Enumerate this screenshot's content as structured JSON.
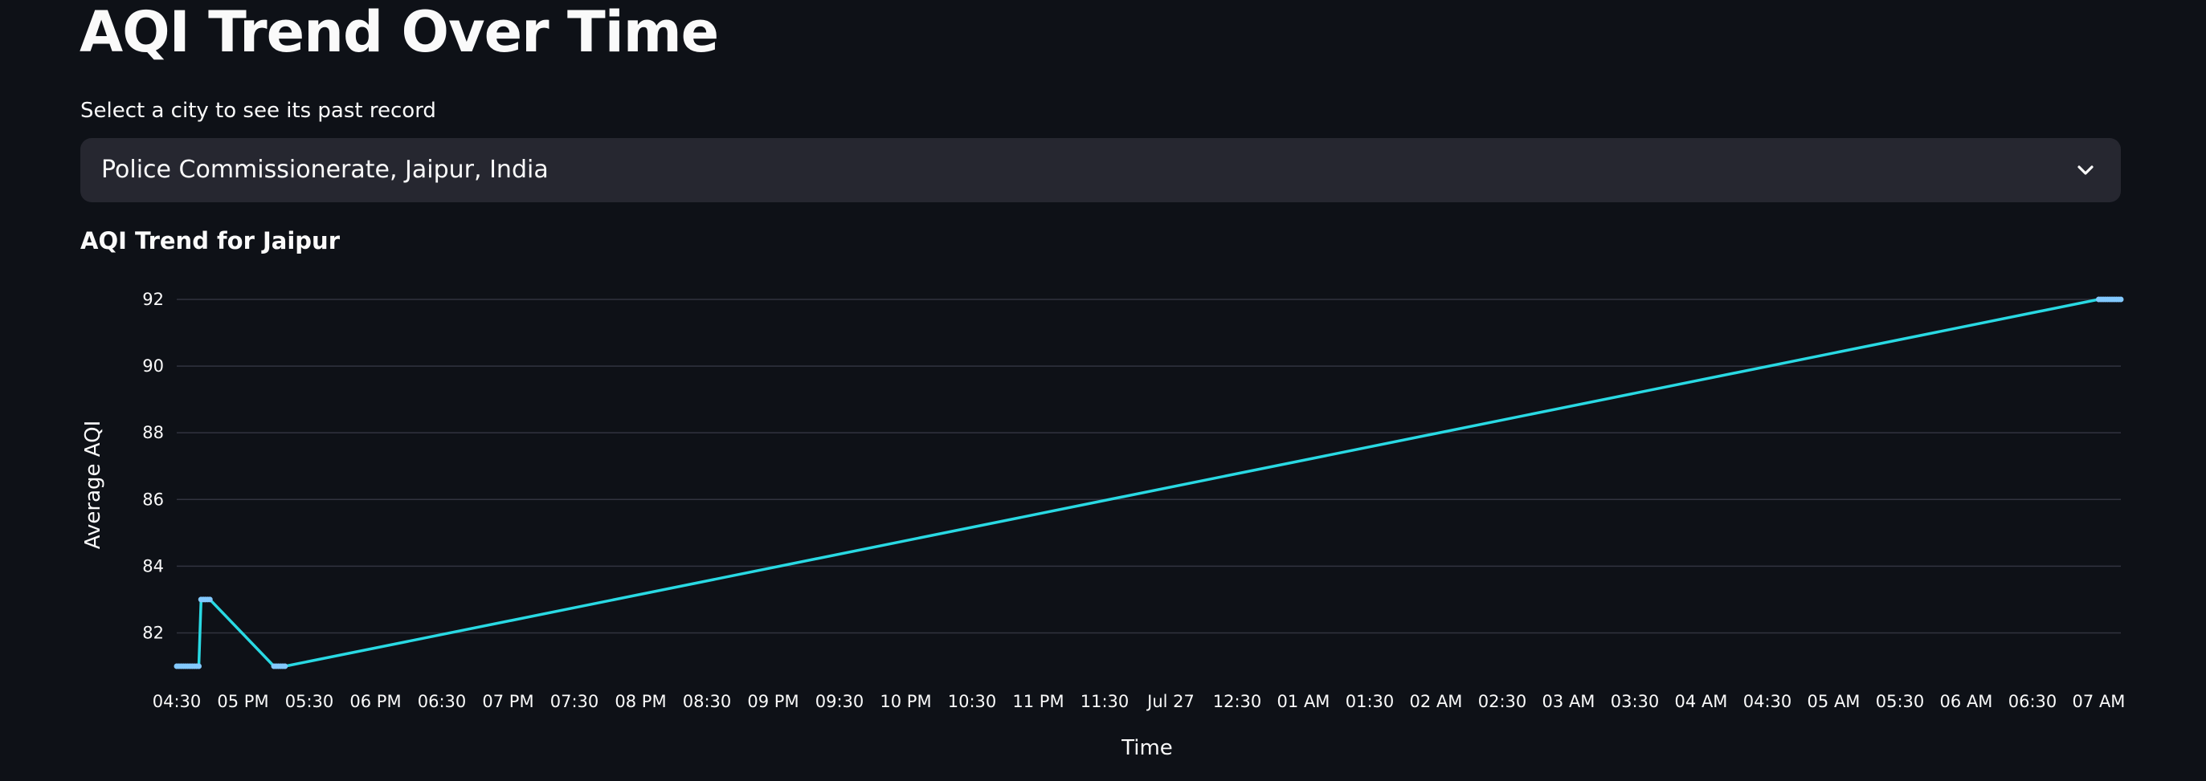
{
  "page": {
    "title": "AQI Trend Over Time",
    "select_label": "Select a city to see its past record",
    "selected_city": "Police Commissionerate, Jaipur, India",
    "chart_heading": "AQI Trend for Jaipur"
  },
  "icons": {
    "dropdown": "chevron-down-icon"
  },
  "colors": {
    "background": "#0e1117",
    "select_background": "#262730",
    "line": "#29d9e3",
    "point": "#83c9ff",
    "grid": "#31333f"
  },
  "chart_data": {
    "type": "line",
    "title": "AQI Trend for Jaipur",
    "xlabel": "Time",
    "ylabel": "Average AQI",
    "x_tick_labels": [
      "04:30",
      "05 PM",
      "05:30",
      "06 PM",
      "06:30",
      "07 PM",
      "07:30",
      "08 PM",
      "08:30",
      "09 PM",
      "09:30",
      "10 PM",
      "10:30",
      "11 PM",
      "11:30",
      "Jul 27",
      "12:30",
      "01 AM",
      "01:30",
      "02 AM",
      "02:30",
      "03 AM",
      "03:30",
      "04 AM",
      "04:30",
      "05 AM",
      "05:30",
      "06 AM",
      "06:30",
      "07 AM"
    ],
    "y_ticks": [
      82,
      84,
      86,
      88,
      90,
      92
    ],
    "ylim": [
      81,
      92
    ],
    "xlim": [
      "Jul 26 16:30",
      "Jul 27 07:10"
    ],
    "grid": true,
    "series": [
      {
        "x": [
          "Jul 26 16:30",
          "Jul 26 16:31",
          "Jul 26 16:32",
          "Jul 26 16:33",
          "Jul 26 16:34",
          "Jul 26 16:35",
          "Jul 26 16:36",
          "Jul 26 16:37",
          "Jul 26 16:38",
          "Jul 26 16:39",
          "Jul 26 16:40",
          "Jul 26 16:41",
          "Jul 26 16:42",
          "Jul 26 16:43",
          "Jul 26 16:44",
          "Jul 26 16:45",
          "Jul 26 17:14",
          "Jul 26 17:15",
          "Jul 26 17:16",
          "Jul 26 17:17",
          "Jul 26 17:18",
          "Jul 26 17:19",
          "Jul 27 07:00",
          "Jul 27 07:01",
          "Jul 27 07:02",
          "Jul 27 07:03",
          "Jul 27 07:04",
          "Jul 27 07:05",
          "Jul 27 07:06",
          "Jul 27 07:07",
          "Jul 27 07:08",
          "Jul 27 07:09",
          "Jul 27 07:10"
        ],
        "values": [
          81,
          81,
          81,
          81,
          81,
          81,
          81,
          81,
          81,
          81,
          81,
          83,
          83,
          83,
          83,
          83,
          81,
          81,
          81,
          81,
          81,
          81,
          92,
          92,
          92,
          92,
          92,
          92,
          92,
          92,
          92,
          92,
          92
        ]
      }
    ]
  }
}
